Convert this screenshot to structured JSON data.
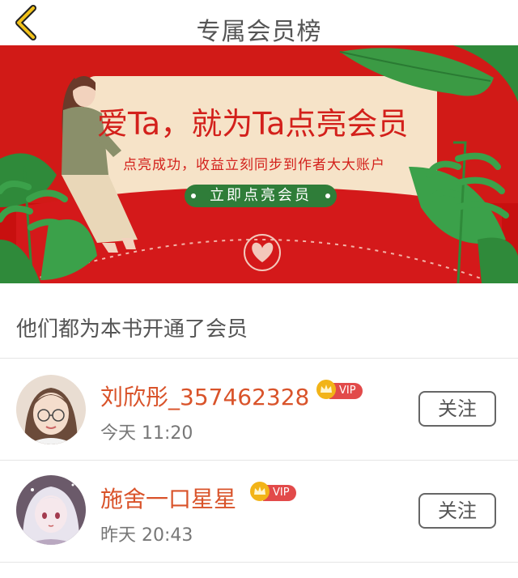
{
  "header": {
    "title": "专属会员榜",
    "back_icon": "chevron-left-icon"
  },
  "banner": {
    "headline": "爱Ta，就为Ta点亮会员",
    "subtitle": "点亮成功，收益立刻同步到作者大大账户",
    "button_label": "立即点亮会员",
    "colors": {
      "background": "#d11a17",
      "card": "#f6e3c8",
      "button": "#2f7d39"
    }
  },
  "section": {
    "label": "他们都为本书开通了会员"
  },
  "members": [
    {
      "name": "刘欣彤_357462328",
      "badge": "VIP",
      "time": "今天 11:20",
      "follow_label": "关注"
    },
    {
      "name": "施舍一口星星",
      "badge": "VIP",
      "time": "昨天 20:43",
      "follow_label": "关注"
    }
  ],
  "colors": {
    "accent": "#d9532a",
    "vip": "#e24a4a",
    "crown": "#f2b418"
  }
}
